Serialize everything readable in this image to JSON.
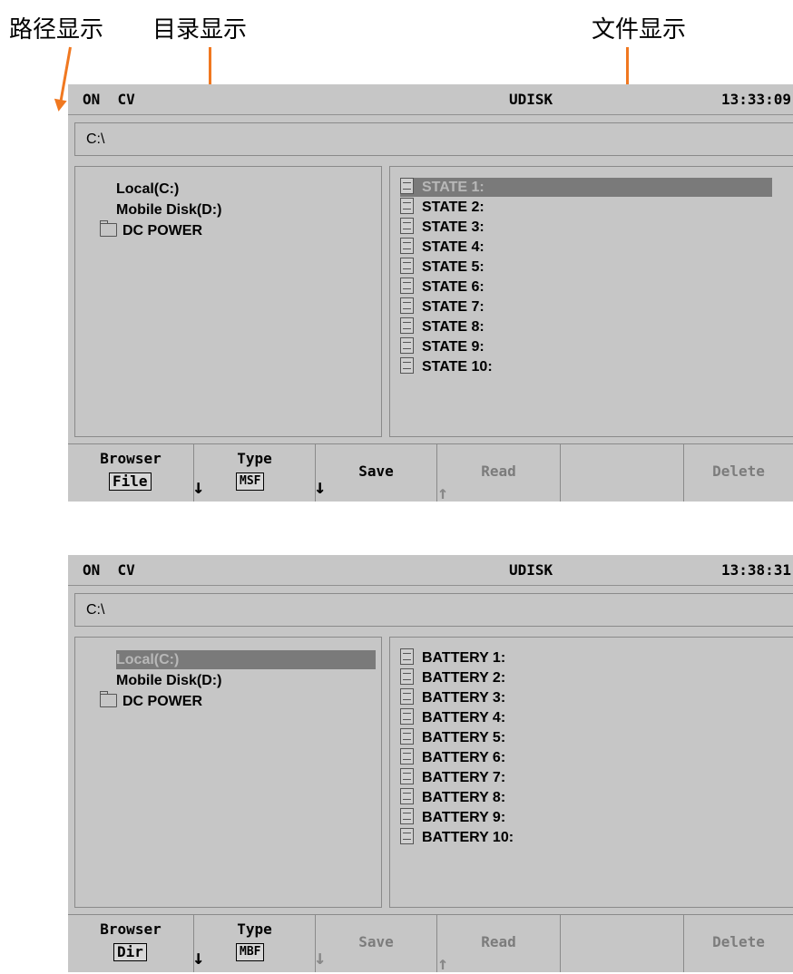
{
  "annotations": {
    "path": "路径显示",
    "dir": "目录显示",
    "file": "文件显示"
  },
  "colors": {
    "arrow": "#f07820",
    "screen_bg": "#c6c6c6",
    "selected_bg": "#7a7a7a"
  },
  "screens": [
    {
      "status": {
        "left": "ON  CV",
        "center": "UDISK",
        "time": "13:33:09"
      },
      "path": "C:\\",
      "dirs": [
        {
          "label": "Local(C:)",
          "icon": "none",
          "selected": false
        },
        {
          "label": "Mobile Disk(D:)",
          "icon": "none",
          "selected": false
        },
        {
          "label": "DC POWER",
          "icon": "folder-icon",
          "selected": false
        }
      ],
      "files": [
        "STATE 1:",
        "STATE 2:",
        "STATE 3:",
        "STATE 4:",
        "STATE 5:",
        "STATE 6:",
        "STATE 7:",
        "STATE 8:",
        "STATE 9:",
        "STATE 10:"
      ],
      "selected_file_index": 0,
      "softkeys": {
        "browser": {
          "label": "Browser",
          "value": "File"
        },
        "type": {
          "label": "Type",
          "value": "MSF"
        },
        "save": {
          "label": "Save",
          "enabled": true
        },
        "read": {
          "label": "Read",
          "enabled": false
        },
        "empty": "",
        "delete": {
          "label": "Delete",
          "enabled": false
        }
      }
    },
    {
      "status": {
        "left": "ON  CV",
        "center": "UDISK",
        "time": "13:38:31"
      },
      "path": "C:\\",
      "dirs": [
        {
          "label": "Local(C:)",
          "icon": "none",
          "selected": true
        },
        {
          "label": "Mobile Disk(D:)",
          "icon": "none",
          "selected": false
        },
        {
          "label": "DC POWER",
          "icon": "folder-icon",
          "selected": false
        }
      ],
      "files": [
        "BATTERY 1:",
        "BATTERY 2:",
        "BATTERY 3:",
        "BATTERY 4:",
        "BATTERY 5:",
        "BATTERY 6:",
        "BATTERY 7:",
        "BATTERY 8:",
        "BATTERY 9:",
        "BATTERY 10:"
      ],
      "selected_file_index": -1,
      "softkeys": {
        "browser": {
          "label": "Browser",
          "value": "Dir"
        },
        "type": {
          "label": "Type",
          "value": "MBF"
        },
        "save": {
          "label": "Save",
          "enabled": false
        },
        "read": {
          "label": "Read",
          "enabled": false
        },
        "empty": "",
        "delete": {
          "label": "Delete",
          "enabled": false
        }
      }
    }
  ]
}
